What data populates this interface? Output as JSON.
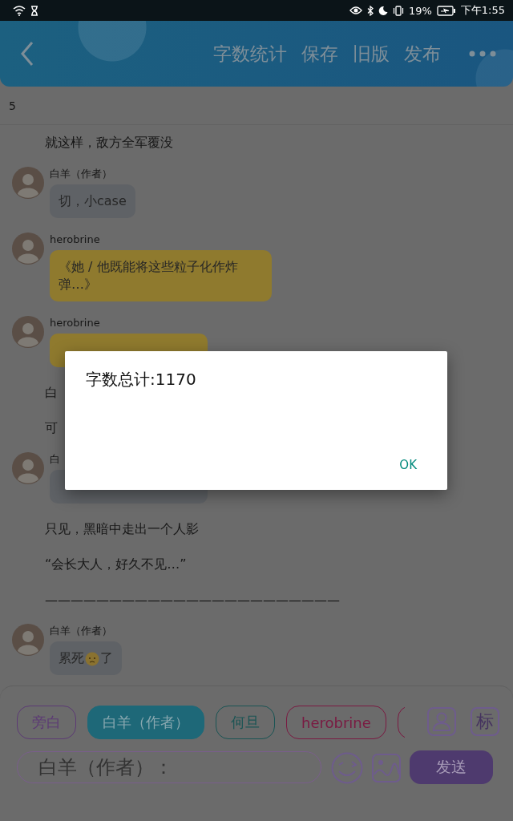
{
  "status_bar": {
    "battery": "19%",
    "time": "下午1:55"
  },
  "header": {
    "actions": [
      "字数统计",
      "保存",
      "旧版",
      "发布"
    ]
  },
  "chapter_number": "5",
  "chat": [
    {
      "kind": "narration",
      "text": "就这样，敌方全军覆没"
    },
    {
      "kind": "message",
      "name": "白羊（作者）",
      "segments": [
        {
          "kind": "text",
          "text": "切，小case"
        }
      ],
      "color": "#5f6266"
    },
    {
      "kind": "message",
      "name": "herobrine",
      "segments": [
        {
          "kind": "text",
          "text": "《她 / 他既能将这些粒子化作炸弹…》"
        }
      ],
      "color": "#8f7a2e"
    },
    {
      "kind": "message",
      "name": "herobrine",
      "color": "#8f7a2e"
    },
    {
      "kind": "narration",
      "text": "白"
    },
    {
      "kind": "narration",
      "text": "可"
    },
    {
      "kind": "message",
      "name": "白",
      "color": "#5f6266"
    },
    {
      "kind": "narration",
      "text": "只见，黑暗中走出一个人影"
    },
    {
      "kind": "narration",
      "text": "“会长大人，好久不见…”"
    },
    {
      "kind": "narration",
      "text": "———————————————————————"
    },
    {
      "kind": "message",
      "name": "白羊（作者）",
      "segments": [
        {
          "kind": "text",
          "text": "累死"
        },
        {
          "kind": "emoji"
        },
        {
          "kind": "text",
          "text": "了"
        }
      ],
      "color": "#5f6266"
    }
  ],
  "chips": [
    {
      "label": "旁白",
      "color": "#5c3a74",
      "selected": false
    },
    {
      "label": "白羊（作者）",
      "color": "#1e6878",
      "selected": true
    },
    {
      "label": "何旦",
      "color": "#1a5454",
      "selected": false
    },
    {
      "label": "herobrine",
      "color": "#7a1a42",
      "selected": false
    },
    {
      "color": "#7a1a42",
      "selected": false
    }
  ],
  "tag_button": "标",
  "input": {
    "value": "白羊（作者）："
  },
  "send_button": "发送",
  "dialog": {
    "message": "字数总计:1170",
    "ok": "OK"
  }
}
